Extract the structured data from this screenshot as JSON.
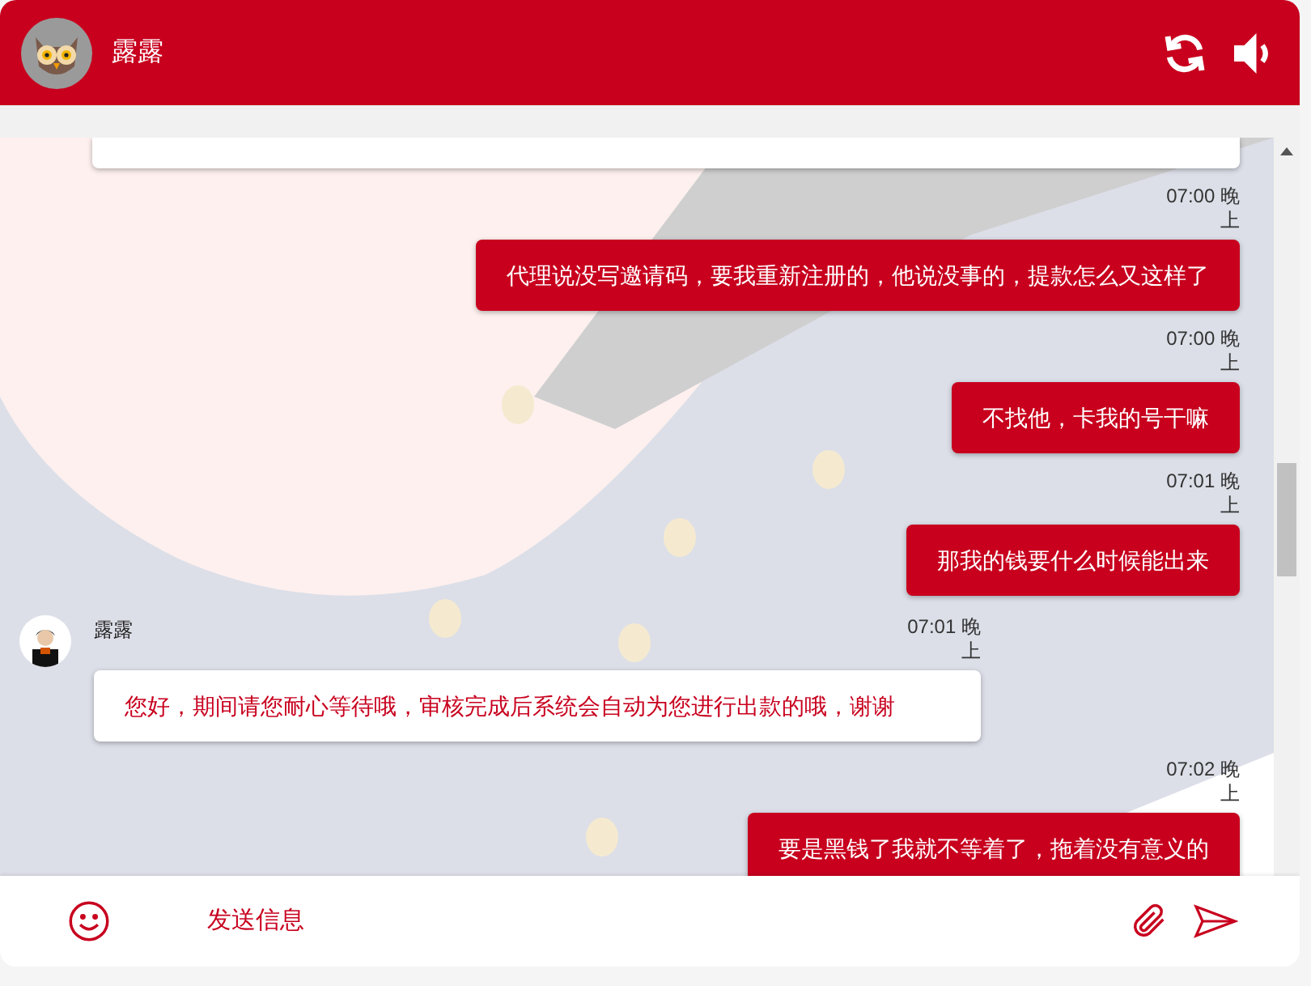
{
  "header": {
    "agent_name": "露露"
  },
  "messages": [
    {
      "kind": "partial"
    },
    {
      "kind": "user",
      "time": "07:00 晚上",
      "text": "代理说没写邀请码，要我重新注册的，他说没事的，提款怎么又这样了"
    },
    {
      "kind": "user",
      "time": "07:00 晚上",
      "text": "不找他，卡我的号干嘛"
    },
    {
      "kind": "user",
      "time": "07:01 晚上",
      "text": "那我的钱要什么时候能出来"
    },
    {
      "kind": "agent",
      "name": "露露",
      "time": "07:01 晚上",
      "text": "您好，期间请您耐心等待哦，审核完成后系统会自动为您进行出款的哦，谢谢"
    },
    {
      "kind": "user",
      "time": "07:02 晚上",
      "text": "要是黑钱了我就不等着了，拖着没有意义的"
    }
  ],
  "composer": {
    "placeholder": "发送信息"
  }
}
